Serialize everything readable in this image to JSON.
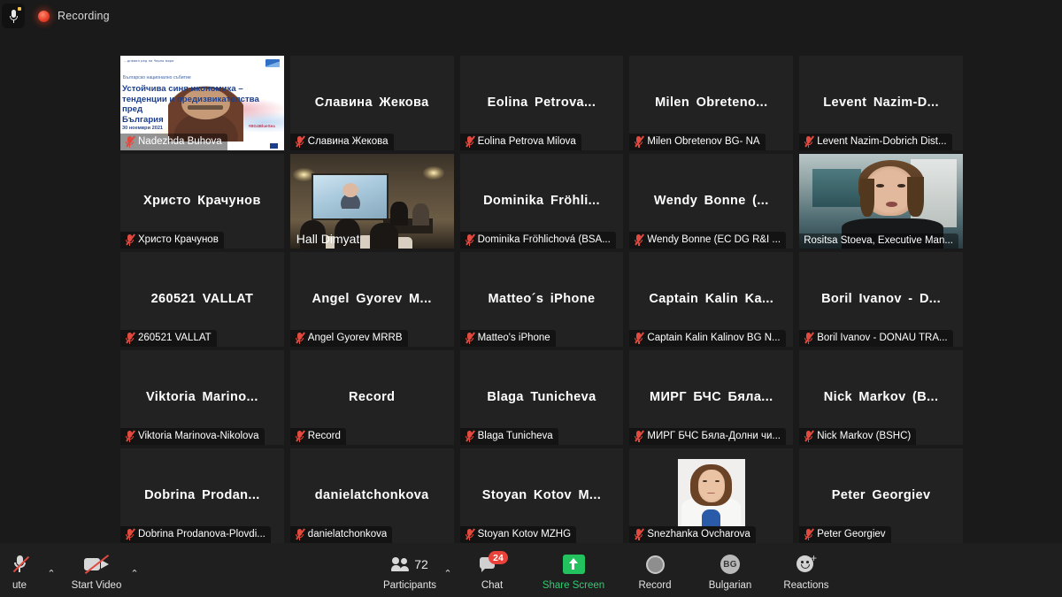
{
  "topbar": {
    "mic_icon": "mic-muted-icon",
    "recording_dot_icon": "recording-dot-icon",
    "recording_label": "Recording"
  },
  "gallery": {
    "tiles": [
      {
        "display_name": "Nadezhda Buhova",
        "name_label": "Nadezhda Buhova",
        "muted": true,
        "video": "slide",
        "slide": {
          "header": "...дневен ред на Черно море",
          "subtitle": "Българско национално събитие",
          "title_line1": "Устойчива синя икономика  –",
          "title_line2": "тенденции и предизвикателства пред",
          "title_line3": "България",
          "date": "30 ноември 2021",
          "hashtag": "#BG4BlueSea"
        }
      },
      {
        "display_name": "Славина Жекова",
        "name_label": "Славина Жекова",
        "muted": true,
        "video": "none"
      },
      {
        "display_name": "Eolina  Petrova...",
        "name_label": "Eolina Petrova Milova",
        "muted": true,
        "video": "none"
      },
      {
        "display_name": "Milen  Obreteno...",
        "name_label": "Milen Obretenov BG- NA",
        "muted": true,
        "video": "none"
      },
      {
        "display_name": "Levent  Nazim-D...",
        "name_label": "Levent Nazim-Dobrich Dist...",
        "muted": true,
        "video": "none"
      },
      {
        "display_name": "Христо Крачунов",
        "name_label": "Христо Крачунов",
        "muted": true,
        "video": "none"
      },
      {
        "display_name": "Hall Dimyat",
        "name_label": "Hall Dimyat",
        "muted": false,
        "video": "hall"
      },
      {
        "display_name": "Dominika  Fröhli...",
        "name_label": "Dominika Fröhlichová (BSA...",
        "muted": true,
        "video": "none"
      },
      {
        "display_name": "Wendy Bonne (...",
        "name_label": "Wendy Bonne (EC DG R&I ...",
        "muted": true,
        "video": "none"
      },
      {
        "display_name": "Rositsa Stoeva",
        "name_label": "Rositsa Stoeva, Executive Man...",
        "muted": false,
        "video": "rositsa",
        "active_speaker": true
      },
      {
        "display_name": "260521  VALLAT",
        "name_label": "260521  VALLAT",
        "muted": true,
        "video": "none"
      },
      {
        "display_name": "Angel Gyorev M...",
        "name_label": "Angel Gyorev MRRB",
        "muted": true,
        "video": "none"
      },
      {
        "display_name": "Matteo´s iPhone",
        "name_label": "Matteo's iPhone",
        "muted": true,
        "video": "none"
      },
      {
        "display_name": "Captain  Kalin  Ka...",
        "name_label": "Captain Kalin Kalinov BG N...",
        "muted": true,
        "video": "none"
      },
      {
        "display_name": "Boril Ivanov - D...",
        "name_label": "Boril Ivanov - DONAU TRA...",
        "muted": true,
        "video": "none"
      },
      {
        "display_name": "Viktoria  Marino...",
        "name_label": "Viktoria Marinova-Nikolova",
        "muted": true,
        "video": "none"
      },
      {
        "display_name": "Record",
        "name_label": "Record",
        "muted": true,
        "video": "none"
      },
      {
        "display_name": "Blaga Tunicheva",
        "name_label": "Blaga Tunicheva",
        "muted": true,
        "video": "none"
      },
      {
        "display_name": "МИРГ БЧС Бяла...",
        "name_label": "МИРГ БЧС Бяла-Долни чи...",
        "muted": true,
        "video": "none"
      },
      {
        "display_name": "Nick  Markov (B...",
        "name_label": "Nick Markov (BSHC)",
        "muted": true,
        "video": "none"
      },
      {
        "display_name": "Dobrina  Prodan...",
        "name_label": "Dobrina Prodanova-Plovdi...",
        "muted": true,
        "video": "none"
      },
      {
        "display_name": "danielatchonkova",
        "name_label": "danielatchonkova",
        "muted": true,
        "video": "none"
      },
      {
        "display_name": "Stoyan Kotov M...",
        "name_label": "Stoyan Kotov MZHG",
        "muted": true,
        "video": "none"
      },
      {
        "display_name": "Snezhanka Ovcharova",
        "name_label": "Snezhanka Ovcharova",
        "muted": true,
        "video": "avatar"
      },
      {
        "display_name": "Peter Georgiev",
        "name_label": "Peter Georgiev",
        "muted": true,
        "video": "none"
      }
    ],
    "active_speaker_border_color": "#b2e03c"
  },
  "toolbar": {
    "unmute": {
      "label": "ute",
      "icon": "mic-muted-icon",
      "caret": "⌃"
    },
    "start_video": {
      "label": "Start Video",
      "icon": "camera-off-icon",
      "caret": "⌃"
    },
    "participants": {
      "label": "Participants",
      "count": "72",
      "icon": "participants-icon",
      "caret": "⌃"
    },
    "chat": {
      "label": "Chat",
      "badge": "24",
      "icon": "chat-bubble-icon"
    },
    "share_screen": {
      "label": "Share Screen",
      "icon": "share-screen-icon",
      "color": "#2ecc71"
    },
    "record": {
      "label": "Record",
      "icon": "record-circle-icon"
    },
    "language": {
      "label": "Bulgarian",
      "code": "BG",
      "icon": "interpretation-globe-icon"
    },
    "reactions": {
      "label": "Reactions",
      "icon": "reactions-smiley-icon"
    }
  }
}
